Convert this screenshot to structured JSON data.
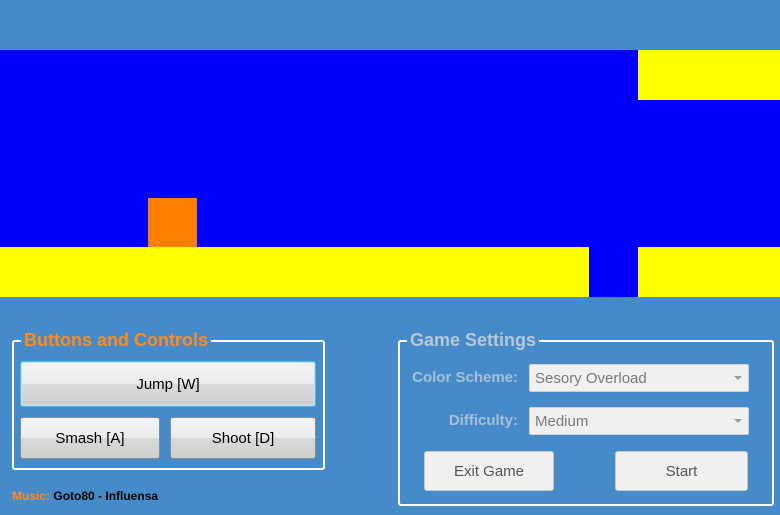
{
  "controls": {
    "title": "Buttons and Controls",
    "jump_label": "Jump [W]",
    "smash_label": "Smash [A]",
    "shoot_label": "Shoot [D]"
  },
  "settings": {
    "title": "Game Settings",
    "color_scheme_label": "Color Scheme:",
    "color_scheme_value": "Sesory Overload",
    "difficulty_label": "Difficulty:",
    "difficulty_value": "Medium",
    "exit_label": "Exit Game",
    "start_label": "Start"
  },
  "music": {
    "label": "Music:",
    "track": "Goto80 - Influensa"
  },
  "colors": {
    "background": "#468bc9",
    "sky": "#0000ff",
    "platform": "#ffff00",
    "player": "#ff8000",
    "accent": "#ff8a1f"
  }
}
